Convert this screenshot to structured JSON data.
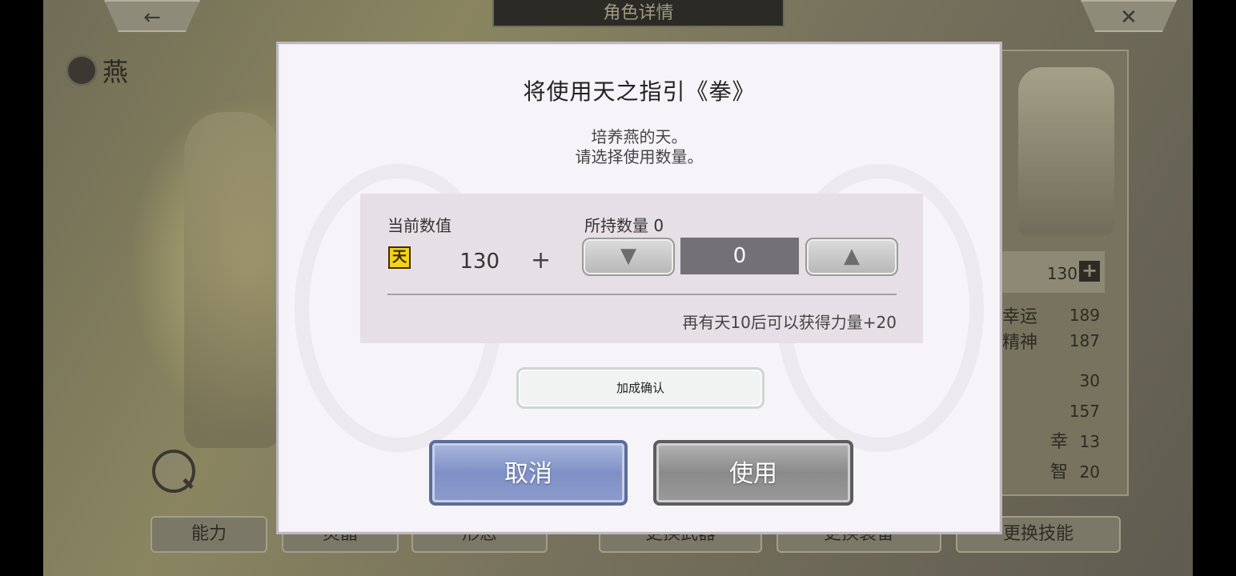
{
  "background": {
    "screen_title": "角色详情",
    "back_icon": "←",
    "close_icon": "✕",
    "character_name": "燕",
    "tabs": [
      "能力",
      "灵晶",
      "形态",
      "更换武器",
      "更换装备",
      "更换技能"
    ],
    "side_stats": {
      "tian_value": "130",
      "luck_label": "幸运",
      "luck_value": "189",
      "spirit_label": "精神",
      "spirit_value": "187",
      "row1_value": "30",
      "row2_value": "157",
      "row3_label": "幸",
      "row3_value": "13",
      "row4_label": "智",
      "row4_value": "20"
    }
  },
  "modal": {
    "title": "将使用天之指引《拳》",
    "subtitle_line1": "培养燕的天。",
    "subtitle_line2": "请选择使用数量。",
    "current_value_label": "当前数值",
    "stat_icon_char": "天",
    "current_value": "130",
    "plus_sign": "+",
    "owned_label": "所持数量 0",
    "decrease_symbol": "▼",
    "increase_symbol": "▲",
    "quantity": "0",
    "bonus_hint": "再有天10后可以获得力量+20",
    "confirm_bonus_label": "加成确认",
    "cancel_label": "取消",
    "use_label": "使用"
  },
  "colors": {
    "modal_bg": "#f7f4f9",
    "panel_bg": "#e6dfe5",
    "cancel_blue": "#7e90c6",
    "use_gray": "#8a8a8a",
    "stat_icon_yellow": "#f2d21c"
  }
}
